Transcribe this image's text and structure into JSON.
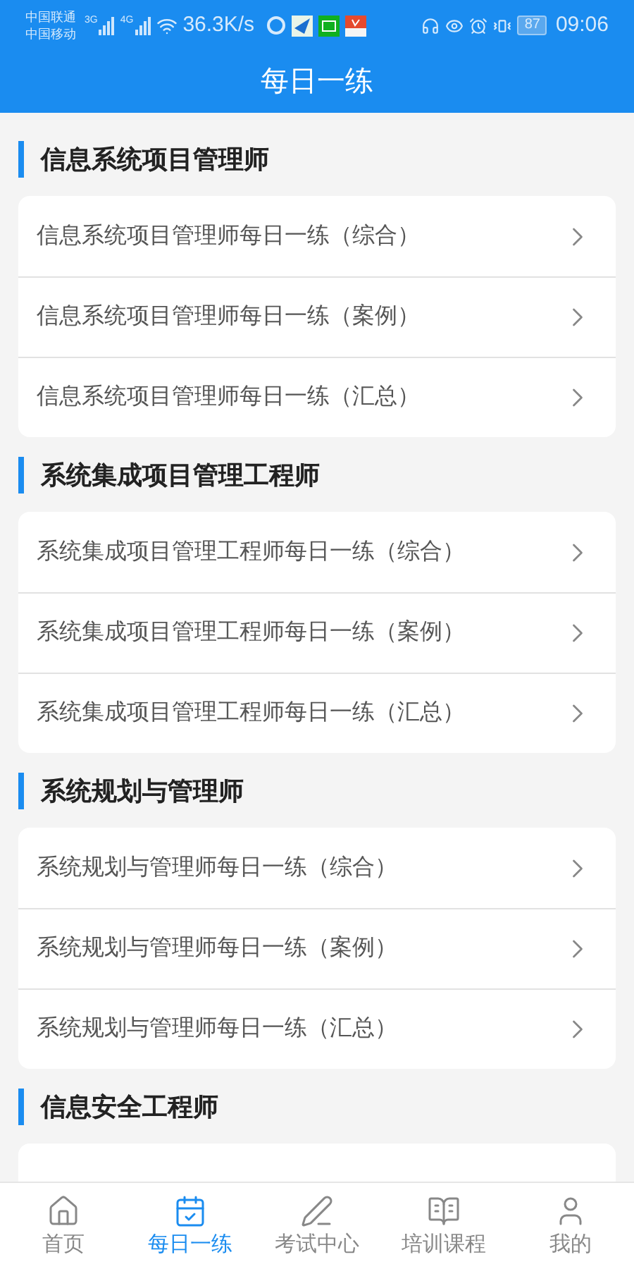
{
  "status_bar": {
    "carriers": [
      "中国联通",
      "中国移动"
    ],
    "networks": [
      "3G",
      "4G"
    ],
    "speed": "36.3K/s",
    "battery": "87",
    "time": "09:06"
  },
  "header": {
    "title": "每日一练"
  },
  "sections": [
    {
      "title": "信息系统项目管理师",
      "items": [
        "信息系统项目管理师每日一练（综合）",
        "信息系统项目管理师每日一练（案例）",
        "信息系统项目管理师每日一练（汇总）"
      ]
    },
    {
      "title": "系统集成项目管理工程师",
      "items": [
        "系统集成项目管理工程师每日一练（综合）",
        "系统集成项目管理工程师每日一练（案例）",
        "系统集成项目管理工程师每日一练（汇总）"
      ]
    },
    {
      "title": "系统规划与管理师",
      "items": [
        "系统规划与管理师每日一练（综合）",
        "系统规划与管理师每日一练（案例）",
        "系统规划与管理师每日一练（汇总）"
      ]
    },
    {
      "title": "信息安全工程师"
    }
  ],
  "tabs": [
    {
      "kind": "home",
      "label": "首页",
      "selected": false
    },
    {
      "kind": "calendar",
      "label": "每日一练",
      "selected": true
    },
    {
      "kind": "pen",
      "label": "考试中心",
      "selected": false
    },
    {
      "kind": "book",
      "label": "培训课程",
      "selected": false
    },
    {
      "kind": "user",
      "label": "我的",
      "selected": false
    }
  ]
}
